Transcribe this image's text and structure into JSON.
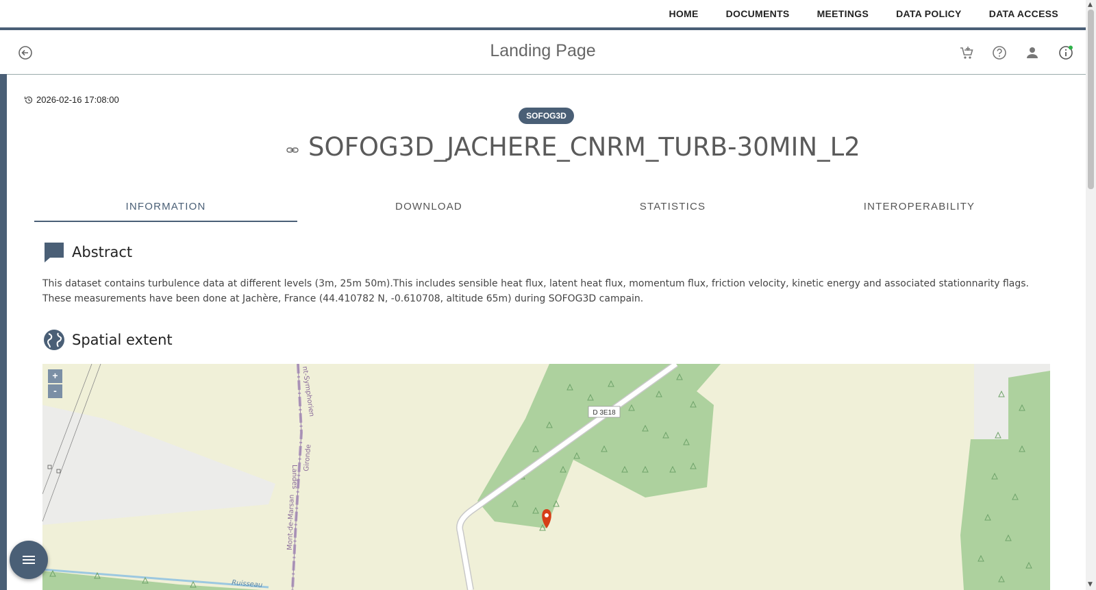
{
  "topnav": {
    "items": [
      "HOME",
      "DOCUMENTS",
      "MEETINGS",
      "DATA POLICY",
      "DATA ACCESS"
    ]
  },
  "header": {
    "title": "Landing Page",
    "icons": [
      "back-icon",
      "cart-icon",
      "help-icon",
      "user-icon",
      "info-icon"
    ]
  },
  "dataset": {
    "timestamp": "2026-02-16 17:08:00",
    "badge": "SOFOG3D",
    "title": "SOFOG3D_JACHERE_CNRM_TURB-30MIN_L2"
  },
  "tabs": [
    {
      "label": "INFORMATION",
      "active": true
    },
    {
      "label": "DOWNLOAD",
      "active": false
    },
    {
      "label": "STATISTICS",
      "active": false
    },
    {
      "label": "INTEROPERABILITY",
      "active": false
    }
  ],
  "abstract": {
    "heading": "Abstract",
    "text": "This dataset contains turbulence data at different levels (3m, 25m 50m).This includes sensible heat flux, latent heat flux, momentum flux, friction velocity, kinetic energy and associated stationnarity flags. These measurements have been done at Jachère, France (44.410782 N, -0.610708, altitude 65m) during SOFOG3D campain."
  },
  "spatial": {
    "heading": "Spatial extent",
    "map_labels": {
      "road": "D 3E18",
      "boundary_1": "Landes",
      "boundary_2": "Gironde",
      "boundary_3": "Mont-de-Marsan",
      "boundary_4": "nt-Symphorien",
      "stream": "Ruisseau"
    },
    "zoom_in": "+",
    "zoom_out": "-"
  },
  "colors": {
    "accent": "#4a5f76",
    "forest": "#add19e",
    "land": "#f0f0d8",
    "marker": "#d63e17"
  }
}
